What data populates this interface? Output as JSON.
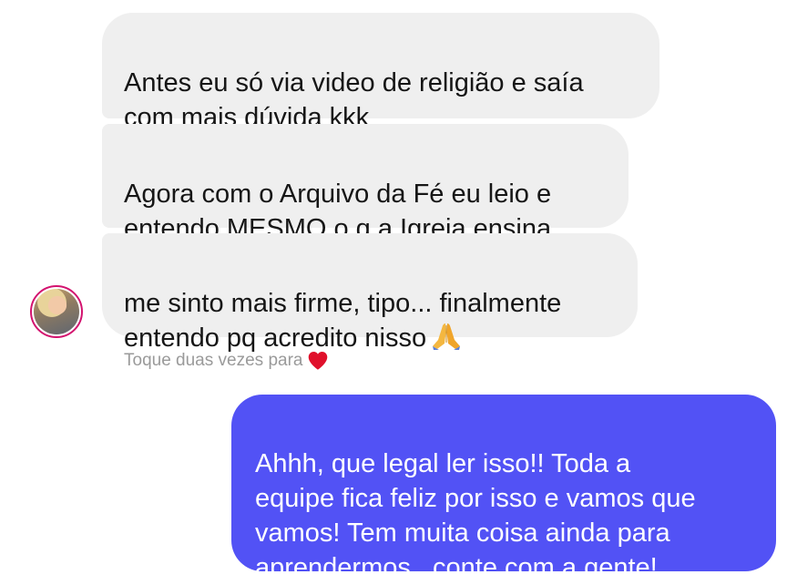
{
  "conversation": {
    "incoming_messages": [
      {
        "text": "Antes eu só via video de religião e saía\ncom mais dúvida kkk"
      },
      {
        "text": "Agora com o Arquivo da Fé eu leio e\nentendo MESMO o q a Igreja ensina"
      },
      {
        "text": "me sinto mais firme, tipo... finalmente\nentendo pq acredito nisso",
        "emoji_icon": "praying-hands-icon"
      }
    ],
    "reaction_hint": {
      "text": "Toque duas vezes para",
      "icon": "heart-icon",
      "icon_color": "#e0102b"
    },
    "outgoing_message": {
      "text": "Ahhh, que legal ler isso!! Toda a\nequipe fica feliz por isso e vamos que\nvamos! Tem muita coisa ainda para\naprendermos...conte com a gente!"
    },
    "colors": {
      "incoming_bubble": "#efefef",
      "outgoing_bubble": "#5252f5",
      "avatar_ring": "#d3136f"
    }
  }
}
